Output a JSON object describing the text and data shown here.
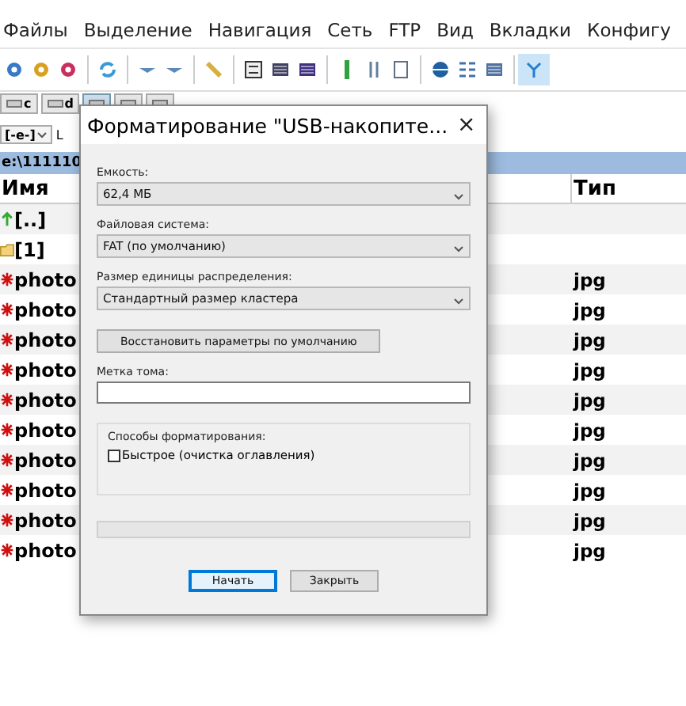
{
  "menu": [
    "Файлы",
    "Выделение",
    "Навигация",
    "Сеть",
    "FTP",
    "Вид",
    "Вкладки",
    "Конфигу"
  ],
  "drives": [
    {
      "label": "c",
      "selected": false
    },
    {
      "label": "d",
      "selected": false
    },
    {
      "selected": true
    },
    {
      "selected": false
    },
    {
      "selected": false
    }
  ],
  "path_bar": {
    "drive": "[-e-]",
    "free": "L"
  },
  "path_header": "e:\\111110",
  "table": {
    "columns": [
      "Имя",
      "Тип"
    ],
    "rows": [
      {
        "kind": "up",
        "name": "[..]",
        "type": ""
      },
      {
        "kind": "folder",
        "name": "[1]",
        "type": ""
      },
      {
        "kind": "file",
        "name": "photo",
        "type": "jpg"
      },
      {
        "kind": "file",
        "name": "photo",
        "type": "jpg"
      },
      {
        "kind": "file",
        "name": "photo",
        "type": "jpg"
      },
      {
        "kind": "file",
        "name": "photo",
        "type": "jpg"
      },
      {
        "kind": "file",
        "name": "photo",
        "type": "jpg"
      },
      {
        "kind": "file",
        "name": "photo",
        "type": "jpg"
      },
      {
        "kind": "file",
        "name": "photo",
        "type": "jpg"
      },
      {
        "kind": "file",
        "name": "photo",
        "type": "jpg"
      },
      {
        "kind": "file",
        "name": "photo",
        "type": "jpg"
      },
      {
        "kind": "file",
        "name": "photo",
        "type": "jpg"
      }
    ]
  },
  "dialog": {
    "title": "Форматирование \"USB-накопите...",
    "close_label": "×",
    "fields": [
      {
        "label": "Емкость:",
        "value": "62,4 МБ"
      },
      {
        "label": "Файловая система:",
        "value": "FAT (по умолчанию)"
      },
      {
        "label": "Размер единицы распределения:",
        "value": "Стандартный размер кластера"
      }
    ],
    "restore_button": "Восстановить параметры по умолчанию",
    "volume_label": {
      "label": "Метка тома:"
    },
    "options": {
      "title": "Способы форматирования:",
      "quick": {
        "label": "Быстрое (очистка оглавления)",
        "checked": false
      }
    },
    "progress": {
      "level": 0
    },
    "buttons": [
      {
        "label": "Начать",
        "default": true
      },
      {
        "label": "Закрыть",
        "default": false
      }
    ]
  }
}
